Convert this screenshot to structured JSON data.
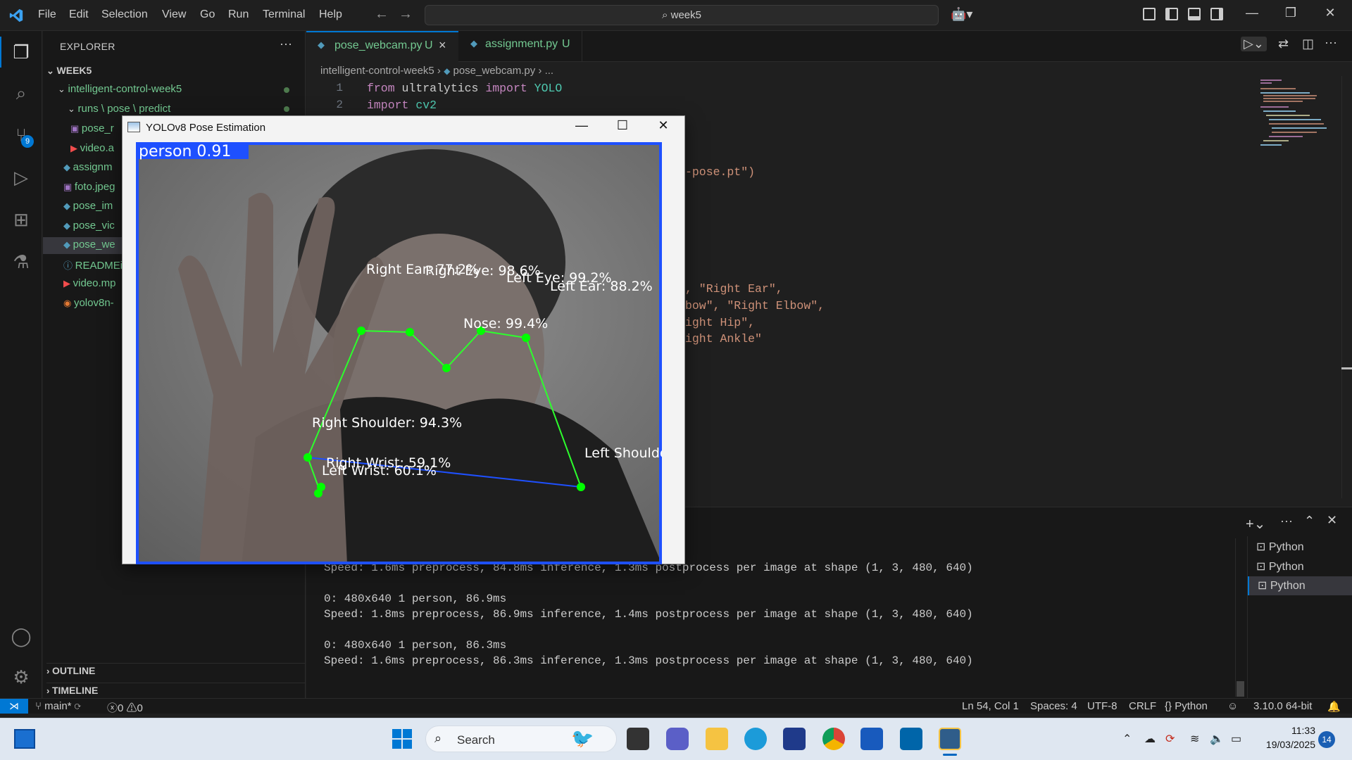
{
  "menu": [
    "File",
    "Edit",
    "Selection",
    "View",
    "Go",
    "Run",
    "Terminal",
    "Help"
  ],
  "command_center": "week5",
  "explorer": {
    "title": "EXPLORER",
    "section": "WEEK5",
    "items": [
      {
        "label": "intelligent-control-week5",
        "icon": "folder"
      },
      {
        "label": "runs \\ pose \\ predict",
        "icon": "folder"
      },
      {
        "label": "pose_r",
        "icon": "image-file"
      },
      {
        "label": "video.a",
        "icon": "video-file"
      },
      {
        "label": "assignm",
        "icon": "python-file"
      },
      {
        "label": "foto.jpeg",
        "icon": "image-file"
      },
      {
        "label": "pose_im",
        "icon": "python-file"
      },
      {
        "label": "pose_vic",
        "icon": "python-file"
      },
      {
        "label": "pose_we",
        "icon": "python-file"
      },
      {
        "label": "READMEi",
        "icon": "info-file"
      },
      {
        "label": "video.mp",
        "icon": "video-file"
      },
      {
        "label": "yolov8n-",
        "icon": "rss-file"
      }
    ],
    "outline": "OUTLINE",
    "timeline": "TIMELINE"
  },
  "tabs": [
    {
      "label": "pose_webcam.py",
      "status": "U"
    },
    {
      "label": "assignment.py",
      "status": "U"
    }
  ],
  "breadcrumb": {
    "folder": "intelligent-control-week5",
    "file": "pose_webcam.py",
    "more": "..."
  },
  "code": {
    "line1": {
      "num": "1",
      "kw": "from",
      "mod": " ultralytics ",
      "kw2": "import",
      "cls": " YOLO"
    },
    "line2": {
      "num": "2",
      "kw": "import",
      "mod": " cv2"
    },
    "frag1": "-pose.pt\")",
    "frag2": ", \"Right Ear\",",
    "frag3": "bow\", \"Right Elbow\",",
    "frag4": "ight Hip\",",
    "frag5": "ight Ankle\""
  },
  "terminal": {
    "lines": [
      "Speed: 1.6ms preprocess, 84.8ms inference, 1.3ms postprocess per image at shape (1, 3, 480, 640)",
      "",
      "0: 480x640 1 person, 86.9ms",
      "Speed: 1.8ms preprocess, 86.9ms inference, 1.4ms postprocess per image at shape (1, 3, 480, 640)",
      "",
      "0: 480x640 1 person, 86.3ms",
      "Speed: 1.6ms preprocess, 86.3ms inference, 1.3ms postprocess per image at shape (1, 3, 480, 640)"
    ],
    "sessions": [
      "Python",
      "Python",
      "Python"
    ]
  },
  "status": {
    "branch": "main*",
    "errors": "0",
    "warnings": "0",
    "position": "Ln 54, Col 1",
    "spaces": "Spaces: 4",
    "encoding": "UTF-8",
    "eol": "CRLF",
    "language": "Python",
    "interpreter": "3.10.0 64-bit"
  },
  "pose_window": {
    "title": "YOLOv8 Pose Estimation",
    "box_label": "person 0.91",
    "keypoints": [
      {
        "label": "Right Ear: 77.2%"
      },
      {
        "label": "Right Eye: 98.6%"
      },
      {
        "label": "Left Eye: 99.2%"
      },
      {
        "label": "Left Ear: 88.2%"
      },
      {
        "label": "Nose: 99.4%"
      },
      {
        "label": "Right Shoulder: 94.3%"
      },
      {
        "label": "Left Shoulder:"
      },
      {
        "label": "Right Wrist: 59.1%"
      },
      {
        "label": "Left Wrist: 60.1%"
      }
    ]
  },
  "taskbar": {
    "search": "Search",
    "time": "11:33",
    "date": "19/03/2025",
    "notifications": "14"
  },
  "colors": {
    "accent": "#0078d4",
    "keypoint": "#00ff00",
    "skeleton_blue": "#1e50ff"
  }
}
